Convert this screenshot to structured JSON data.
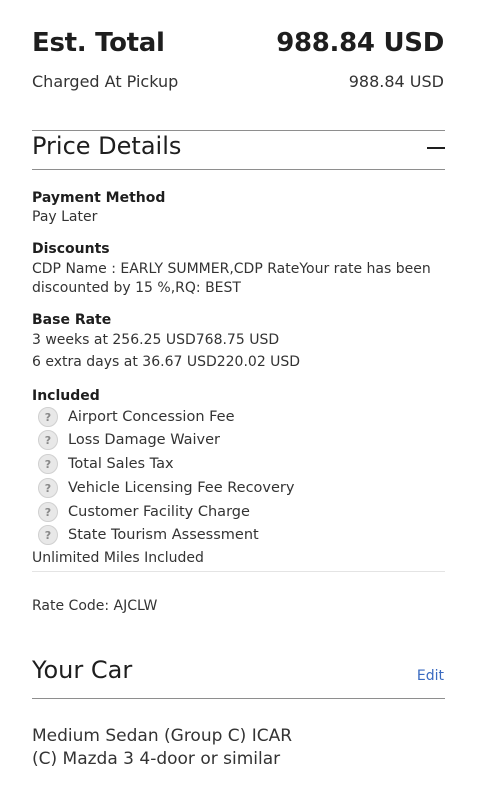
{
  "summary": {
    "total_label": "Est. Total",
    "total_amount": "988.84 USD",
    "charged_label": "Charged At Pickup",
    "charged_amount": "988.84 USD"
  },
  "price_details": {
    "title": "Price Details",
    "payment_method": {
      "heading": "Payment Method",
      "value": "Pay Later"
    },
    "discounts": {
      "heading": "Discounts",
      "line1": "CDP Name : EARLY SUMMER,CDP RateYour rate has been",
      "line2": "discounted by 15 %,RQ: BEST"
    },
    "base_rate": {
      "heading": "Base Rate",
      "line1": "3 weeks at 256.25 USD768.75 USD",
      "line2": "6 extra days at 36.67 USD220.02 USD"
    },
    "included": {
      "heading": "Included",
      "items": [
        {
          "label": "Airport Concession Fee",
          "icon": "?"
        },
        {
          "label": "Loss Damage Waiver",
          "icon": "?"
        },
        {
          "label": "Total Sales Tax",
          "icon": "?"
        },
        {
          "label": "Vehicle Licensing Fee Recovery",
          "icon": "?"
        },
        {
          "label": "Customer Facility Charge",
          "icon": "?"
        },
        {
          "label": "State Tourism Assessment",
          "icon": "?"
        }
      ],
      "footer": "Unlimited Miles Included"
    },
    "rate_code": "Rate Code: AJCLW"
  },
  "your_car": {
    "title": "Your Car",
    "edit_label": "Edit",
    "line1": "Medium Sedan (Group C) ICAR",
    "line2": "(C) Mazda 3 4-door or similar"
  },
  "colors": {
    "link": "#3a6ac0",
    "text": "#333333",
    "rule": "#8e8e8e"
  }
}
